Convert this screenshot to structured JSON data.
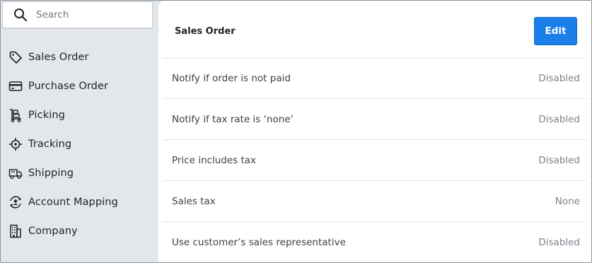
{
  "search": {
    "placeholder": "Search",
    "icon": "search-icon"
  },
  "sidebar": {
    "items": [
      {
        "label": "Sales Order",
        "icon": "tag-icon"
      },
      {
        "label": "Purchase Order",
        "icon": "credit-card-icon"
      },
      {
        "label": "Picking",
        "icon": "hand-truck-icon"
      },
      {
        "label": "Tracking",
        "icon": "crosshair-icon"
      },
      {
        "label": "Shipping",
        "icon": "truck-icon"
      },
      {
        "label": "Account Mapping",
        "icon": "user-sync-icon"
      },
      {
        "label": "Company",
        "icon": "building-icon"
      }
    ]
  },
  "main": {
    "title": "Sales Order",
    "edit_label": "Edit",
    "settings": [
      {
        "label": "Notify if order is not paid",
        "value": "Disabled"
      },
      {
        "label": "Notify if tax rate is ‘none’",
        "value": "Disabled"
      },
      {
        "label": "Price includes tax",
        "value": "Disabled"
      },
      {
        "label": "Sales tax",
        "value": "None"
      },
      {
        "label": "Use customer’s sales representative",
        "value": "Disabled"
      }
    ]
  },
  "colors": {
    "accent": "#1a7fe8",
    "sidebar_bg": "#e3e7ec",
    "muted_text": "#7d848c"
  }
}
